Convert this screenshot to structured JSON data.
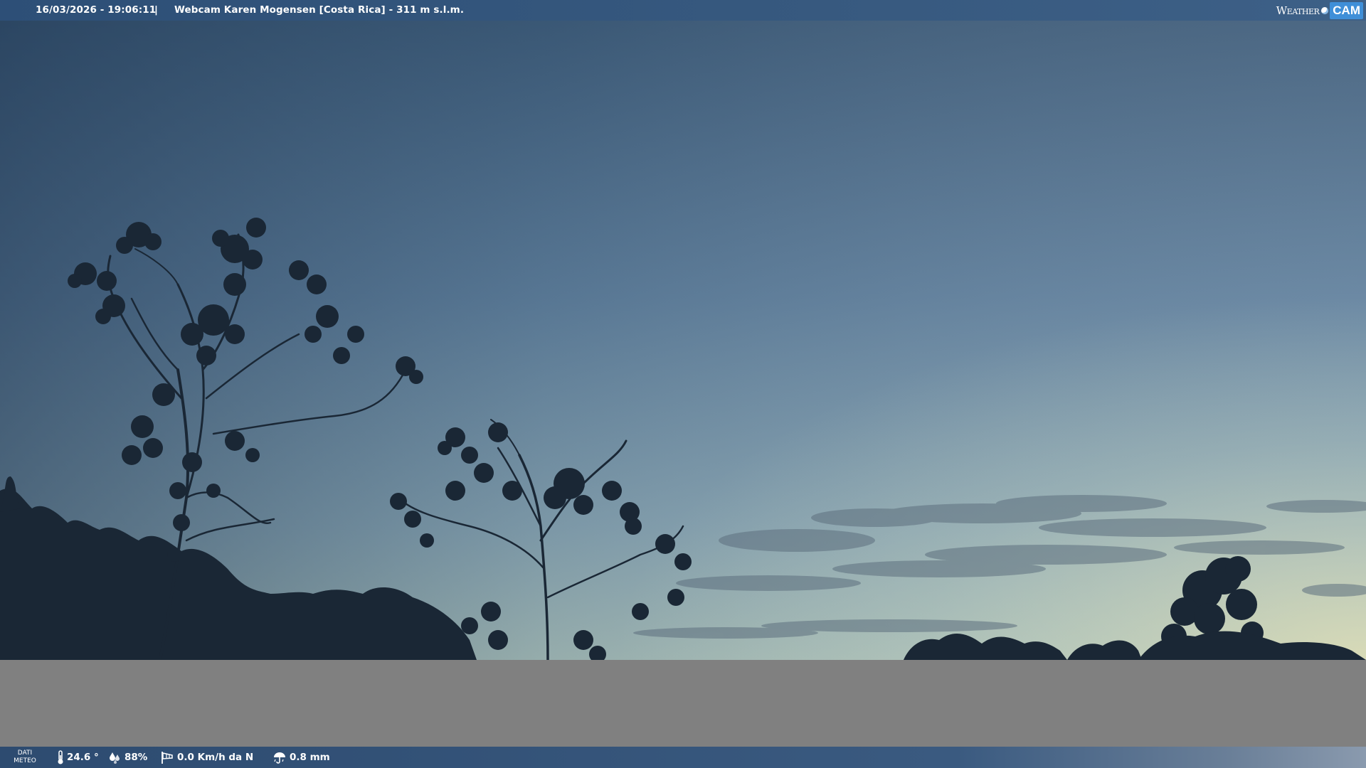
{
  "header": {
    "datetime": "16/03/2026 - 19:06:11",
    "separator": "|",
    "title": "Webcam Karen Mogensen [Costa Rica]  - 311 m s.l.m.",
    "logo": {
      "word1": "Weather",
      "word2": "CAM"
    }
  },
  "colors": {
    "sky_top": "#3d5a7a",
    "sky_mid": "#6e8ca6",
    "sky_horizon": "#c8d6b9",
    "silhouette": "#1c2a38",
    "gray_area": "#808080",
    "logo_accent": "#3f8fd8"
  },
  "footer": {
    "label_line1": "DATI",
    "label_line2": "METEO",
    "temperature": "24.6 °",
    "humidity": "88%",
    "wind": "0.0 Km/h da N",
    "rain": "0.8 mm",
    "icons": [
      "thermometer-icon",
      "humidity-drops-icon",
      "wind-sock-icon",
      "rain-umbrella-icon"
    ]
  }
}
